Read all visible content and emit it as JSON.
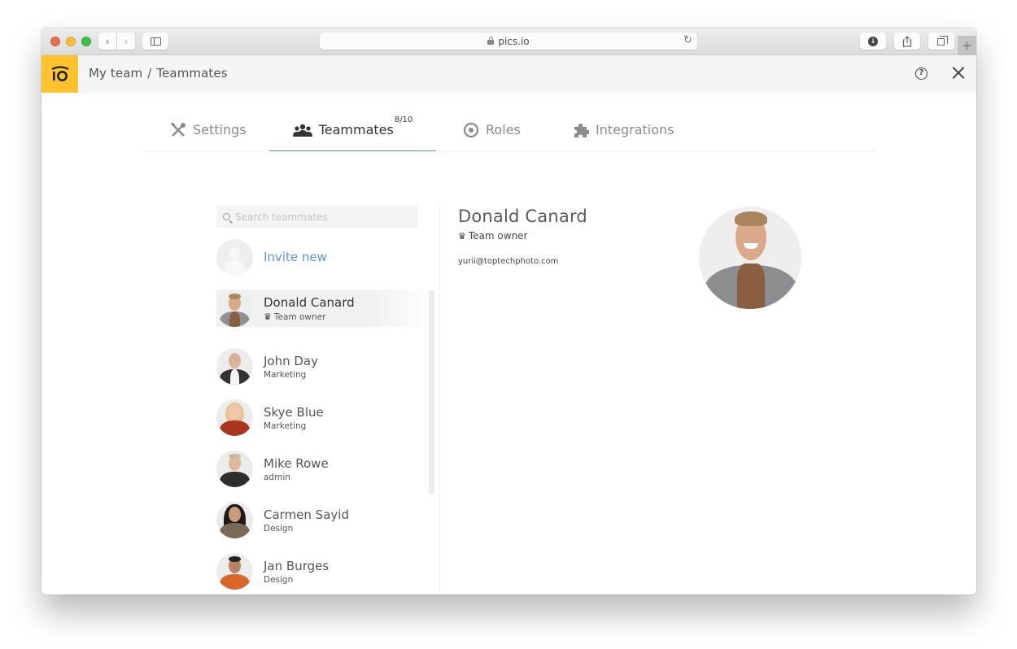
{
  "browser": {
    "url": "pics.io",
    "buttons": {
      "back": "‹",
      "forward": "›",
      "reload": "↻",
      "share": "⇪",
      "new_tab": "+"
    }
  },
  "header": {
    "logo_text": "iO",
    "breadcrumb": [
      "My team",
      "Teammates"
    ],
    "breadcrumb_separator": "/",
    "help": "?"
  },
  "tabs": [
    {
      "id": "settings",
      "label": "Settings",
      "icon": "tools-icon",
      "active": false
    },
    {
      "id": "teammates",
      "label": "Teammates",
      "badge": "8/10",
      "icon": "people-icon",
      "active": true
    },
    {
      "id": "roles",
      "label": "Roles",
      "icon": "eye-icon",
      "active": false
    },
    {
      "id": "integrations",
      "label": "Integrations",
      "icon": "puzzle-icon",
      "active": false
    }
  ],
  "colors": {
    "brand": "#fec22f",
    "accent": "#5b8fd6",
    "link": "#5a98d8"
  },
  "search": {
    "placeholder": "Search teammates",
    "value": ""
  },
  "invite": {
    "label": "Invite new"
  },
  "members": [
    {
      "name": "Donald Canard",
      "role": "Team owner",
      "owner": true,
      "selected": true
    },
    {
      "name": "John Day",
      "role": "Marketing",
      "owner": false,
      "selected": false
    },
    {
      "name": "Skye Blue",
      "role": "Marketing",
      "owner": false,
      "selected": false
    },
    {
      "name": "Mike Rowe",
      "role": "admin",
      "owner": false,
      "selected": false
    },
    {
      "name": "Carmen Sayid",
      "role": "Design",
      "owner": false,
      "selected": false
    },
    {
      "name": "Jan Burges",
      "role": "Design",
      "owner": false,
      "selected": false
    }
  ],
  "detail": {
    "name": "Donald Canard",
    "role": "Team owner",
    "crown": "♛",
    "email": "yurii@toptechphoto.com"
  }
}
